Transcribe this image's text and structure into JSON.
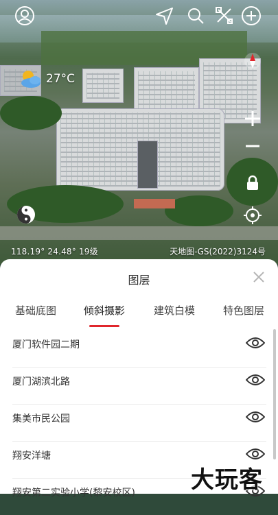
{
  "map": {
    "weather": {
      "icon": "partly-cloudy-icon",
      "temperature": "27°C"
    },
    "coordinates": "118.19°  24.48°  19级",
    "copyright": "天地图-GS(2022)3124号"
  },
  "top_bar": {
    "icons": [
      "user-avatar-icon",
      "navigation-arrow-icon",
      "search-icon",
      "measure-tools-icon",
      "add-icon"
    ]
  },
  "side_controls": {
    "icons": [
      "compass-icon",
      "zoom-in-icon",
      "zoom-out-icon",
      "lock-icon",
      "locate-icon"
    ]
  },
  "panel": {
    "title": "图层",
    "tabs": [
      "基础底图",
      "倾斜摄影",
      "建筑白模",
      "特色图层"
    ],
    "active_tab": "倾斜摄影",
    "items": [
      {
        "name": "厦门软件园二期"
      },
      {
        "name": "厦门湖滨北路"
      },
      {
        "name": "集美市民公园"
      },
      {
        "name": "翔安洋塘"
      },
      {
        "name": "翔安第二实验小学(黎安校区)"
      }
    ]
  },
  "watermark": "大玩客",
  "colors": {
    "accent": "#e0262c"
  }
}
